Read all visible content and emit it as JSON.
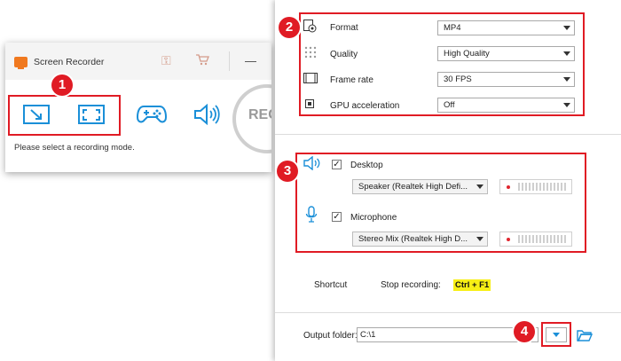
{
  "recorder": {
    "title": "Screen Recorder",
    "rec_label": "REC",
    "status": "Please select a recording mode.",
    "modes": [
      {
        "name": "region-mode-icon"
      },
      {
        "name": "fullscreen-mode-icon"
      },
      {
        "name": "game-mode-icon"
      },
      {
        "name": "audio-mode-icon"
      }
    ]
  },
  "settings": {
    "format": {
      "label": "Format",
      "value": "MP4"
    },
    "quality": {
      "label": "Quality",
      "value": "High Quality"
    },
    "frame_rate": {
      "label": "Frame rate",
      "value": "30 FPS"
    },
    "gpu": {
      "label": "GPU acceleration",
      "value": "Off"
    }
  },
  "audio": {
    "desktop": {
      "label": "Desktop",
      "checked": true,
      "device": "Speaker (Realtek High Defi..."
    },
    "microphone": {
      "label": "Microphone",
      "checked": true,
      "device": "Stereo Mix (Realtek High D..."
    }
  },
  "shortcut": {
    "label": "Shortcut",
    "action": "Stop recording:",
    "keys": "Ctrl + F1"
  },
  "output": {
    "label": "Output folder:",
    "path": "C:\\1"
  },
  "annotations": {
    "badge1": "1",
    "badge2": "2",
    "badge3": "3",
    "badge4": "4"
  },
  "colors": {
    "annotation_red": "#e01b24",
    "accent_blue": "#1a8fd8",
    "shortcut_highlight": "#f7ef15"
  }
}
